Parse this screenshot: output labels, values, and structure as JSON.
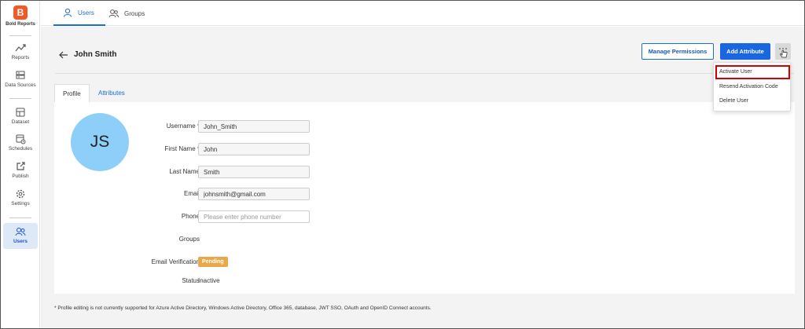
{
  "brand": {
    "name": "Bold Reports",
    "logo_letter": "B"
  },
  "sidebar": {
    "items": [
      {
        "label": "Reports",
        "icon": "trend-icon"
      },
      {
        "label": "Data Sources",
        "icon": "database-icon"
      },
      {
        "label": "Dataset",
        "icon": "dataset-icon"
      },
      {
        "label": "Schedules",
        "icon": "calendar-clock-icon"
      },
      {
        "label": "Publish",
        "icon": "publish-icon"
      },
      {
        "label": "Settings",
        "icon": "gear-icon"
      },
      {
        "label": "Users",
        "icon": "users-icon",
        "active": true
      }
    ]
  },
  "top_tabs": [
    {
      "label": "Users",
      "active": true
    },
    {
      "label": "Groups",
      "active": false
    }
  ],
  "page": {
    "title": "John Smith",
    "manage_permissions_label": "Manage Permissions",
    "add_attribute_label": "Add Attribute"
  },
  "menu": {
    "items": [
      "Activate User",
      "Resend Activation Code",
      "Delete User"
    ],
    "highlighted": "Activate User"
  },
  "card_tabs": [
    {
      "label": "Profile",
      "active": true
    },
    {
      "label": "Attributes",
      "active": false
    }
  ],
  "profile": {
    "avatar_initials": "JS",
    "fields": {
      "username": {
        "label": "Username *",
        "value": "John_Smith"
      },
      "first_name": {
        "label": "First Name *",
        "value": "John"
      },
      "last_name": {
        "label": "Last Name",
        "value": "Smith"
      },
      "email": {
        "label": "Email",
        "value": "johnsmith@gmail.com"
      },
      "phone": {
        "label": "Phone",
        "placeholder": "Please enter phone number"
      },
      "groups": {
        "label": "Groups"
      },
      "email_verification": {
        "label": "Email Verification",
        "value": "Pending"
      },
      "status": {
        "label": "Status",
        "value": "Inactive"
      }
    }
  },
  "footnote": "* Profile editing is not currently supported for Azure Active Directory, Windows Active Directory, Office 365, database, JWT SSO, OAuth and OpenID Connect accounts.",
  "colors": {
    "accent": "#1a66e0",
    "badge": "#e9a94a",
    "avatar": "#8ecffa",
    "highlight": "#d40000"
  }
}
